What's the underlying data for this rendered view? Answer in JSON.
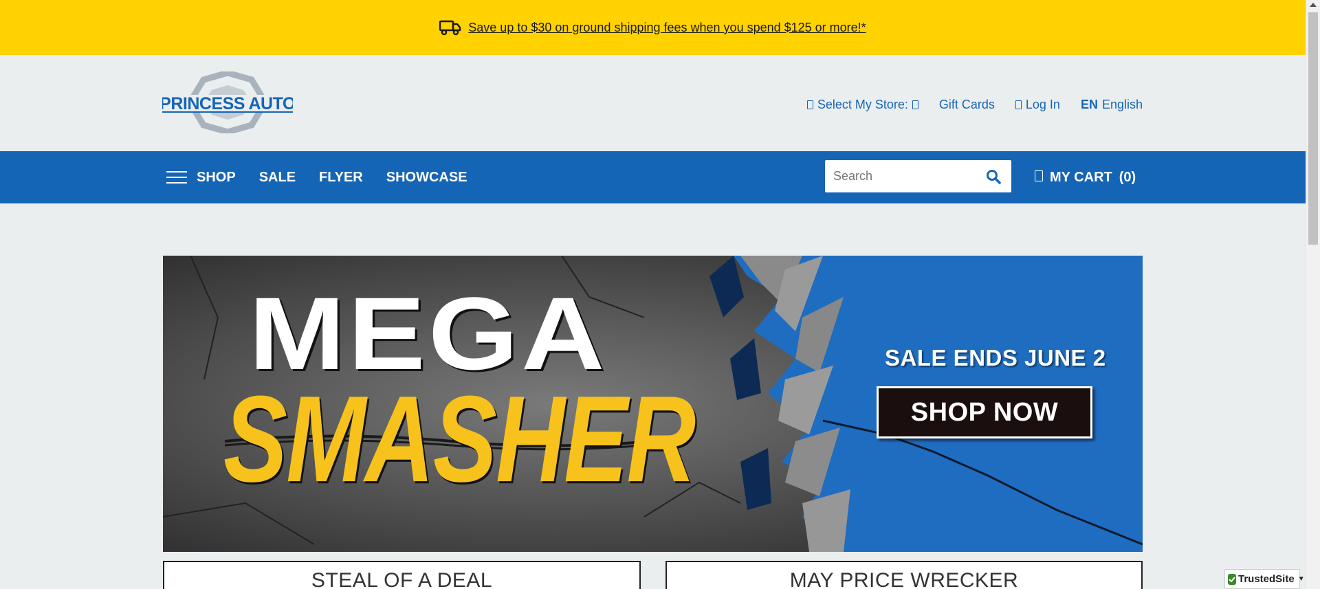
{
  "promo_bar": {
    "text": "Save up to $30 on ground shipping fees when you spend $125 or more!*",
    "icon": "truck-icon",
    "background": "#ffd200"
  },
  "brand": {
    "logo_line1": "PRINCESS AUTO",
    "primary_color": "#1565b7"
  },
  "utility_nav": {
    "store_label": "Select My Store:",
    "gift_cards": "Gift Cards",
    "login": "Log In",
    "lang_code": "EN",
    "lang_name": "English"
  },
  "main_nav": {
    "items": [
      {
        "label": "SHOP"
      },
      {
        "label": "SALE"
      },
      {
        "label": "FLYER"
      },
      {
        "label": "SHOWCASE"
      }
    ],
    "search_placeholder": "Search",
    "cart_label": "MY CART",
    "cart_count": "(0)"
  },
  "hero": {
    "headline_top": "MEGA",
    "headline_bottom": "SMASHER",
    "sale_ends": "SALE ENDS JUNE 2",
    "cta": "SHOP NOW",
    "accent_yellow": "#f7c21b",
    "accent_blue": "#1f6dc0"
  },
  "promo_cards": [
    {
      "title": "STEAL OF A DEAL"
    },
    {
      "title": "MAY PRICE WRECKER"
    }
  ],
  "trusted_badge": {
    "label": "TrustedSite"
  }
}
